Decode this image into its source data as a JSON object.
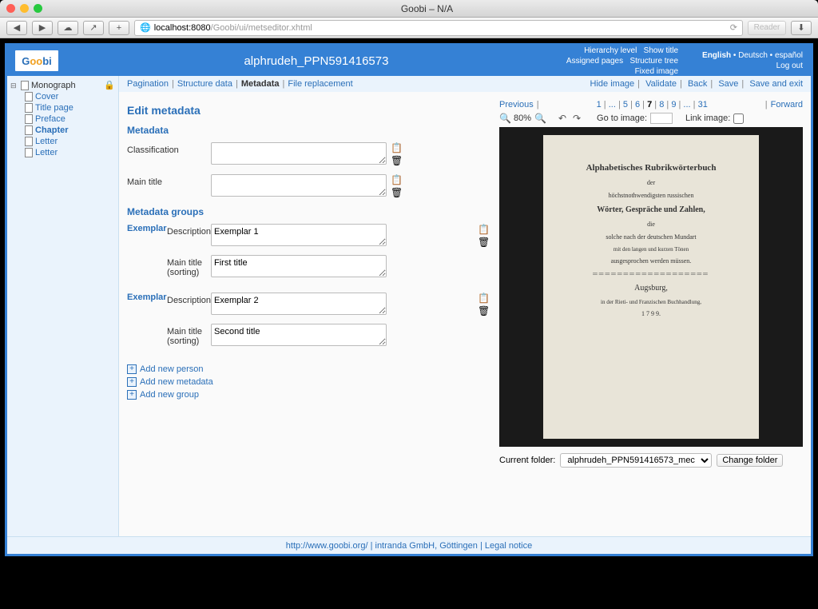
{
  "window_title": "Goobi – N/A",
  "url_host": "localhost:8080",
  "url_path": "/Goobi/ui/metseditor.xhtml",
  "reader_label": "Reader",
  "logo_text": "Goobi",
  "page_title": "alphrudeh_PPN591416573",
  "header_links": {
    "hierarchy": "Hierarchy level",
    "show_title": "Show title",
    "assigned": "Assigned pages",
    "structure": "Structure tree",
    "fixed": "Fixed image",
    "english": "English",
    "deutsch": "Deutsch",
    "espanol": "español",
    "logout": "Log out"
  },
  "sidebar": {
    "root": "Monograph",
    "items": [
      "Cover",
      "Title page",
      "Preface",
      "Chapter",
      "Letter",
      "Letter"
    ],
    "active_index": 3
  },
  "tabs": {
    "pagination": "Pagination",
    "structure": "Structure data",
    "metadata": "Metadata",
    "file": "File replacement",
    "hide": "Hide image",
    "validate": "Validate",
    "back": "Back",
    "save": "Save",
    "save_exit": "Save and exit"
  },
  "form": {
    "heading": "Edit metadata",
    "section1": "Metadata",
    "classification": "Classification",
    "main_title": "Main title",
    "section2": "Metadata groups",
    "exemplar": "Exemplar",
    "description": "Description",
    "main_title_sort": "Main title (sorting)",
    "val_ex1": "Exemplar 1",
    "val_first": "First title",
    "val_ex2": "Exemplar 2",
    "val_second": "Second title",
    "add_person": "Add new person",
    "add_metadata": "Add new metadata",
    "add_group": "Add new group"
  },
  "paginator": {
    "previous": "Previous",
    "forward": "Forward",
    "pages": [
      "1",
      "...",
      "5",
      "6",
      "7",
      "8",
      "9",
      "...",
      "31"
    ],
    "current_index": 4,
    "zoom": "80%",
    "goto": "Go to image:",
    "link": "Link image:"
  },
  "scan_page": {
    "t1": "Alphabetisches Rubrikwörterbuch",
    "t2": "der",
    "t3": "höchstnothwendigsten russischen",
    "t4": "Wörter, Gespräche und Zahlen,",
    "t5": "die",
    "t6": "solche nach der deutschen Mundart",
    "t7": "mit den langen und kurzen Tönen",
    "t8": "ausgesprochen werden müssen.",
    "t9": "Augsburg,",
    "t10": "in der Rieti- und Franzischen Buchhandlung,",
    "t11": "1 7 9 9."
  },
  "folder": {
    "label": "Current folder:",
    "value": "alphrudeh_PPN591416573_mec",
    "change": "Change folder"
  },
  "footer": {
    "url": "http://www.goobi.org/",
    "company": "intranda GmbH, Göttingen",
    "legal": "Legal notice",
    "sep": " | "
  }
}
